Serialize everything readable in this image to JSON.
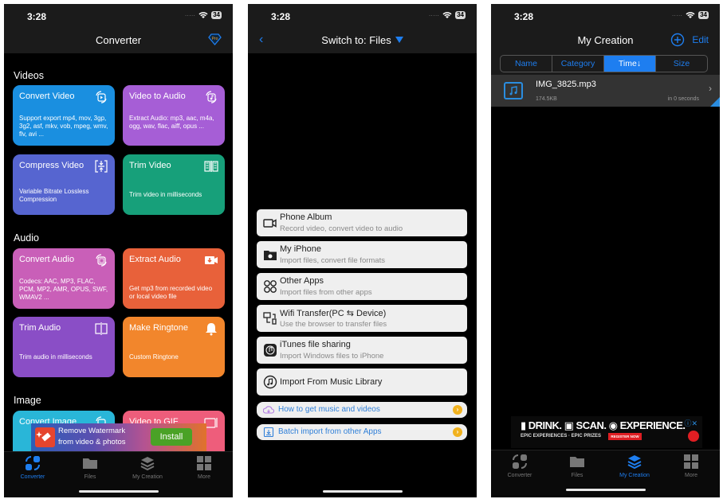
{
  "status": {
    "time": "3:28",
    "battery": "34"
  },
  "screen1": {
    "title": "Converter",
    "pro_badge": "Pro",
    "sections": {
      "videos": "Videos",
      "audio": "Audio",
      "image": "Image"
    },
    "cards": [
      {
        "title": "Convert Video",
        "desc": "Support export mp4, mov, 3gp, 3g2, asf, mkv, vob, mpeg, wmv, flv, avi ...",
        "icon": "convert-video-icon",
        "color": "#1a8fe0"
      },
      {
        "title": "Video to Audio",
        "desc": "Extract Audio: mp3, aac, m4a, ogg, wav, flac, aiff, opus ...",
        "icon": "video-to-audio-icon",
        "color": "#a65ed6"
      },
      {
        "title": "Compress Video",
        "desc": "Variable Bitrate Lossless Compression",
        "icon": "compress-icon",
        "color": "#5665d0"
      },
      {
        "title": "Trim Video",
        "desc": "Trim video in milliseconds",
        "icon": "film-trim-icon",
        "color": "#17a07a"
      },
      {
        "title": "Convert Audio",
        "desc": "Codecs: AAC, MP3, FLAC, PCM, MP2, AMR, OPUS, SWF, WMAV2 ...",
        "icon": "convert-audio-icon",
        "color": "#c95fb8"
      },
      {
        "title": "Extract Audio",
        "desc": "Get mp3 from recorded video or local video file",
        "icon": "video-download-icon",
        "color": "#e8613a"
      },
      {
        "title": "Trim Audio",
        "desc": "Trim audio in milliseconds",
        "icon": "trim-audio-icon",
        "color": "#8a4ec6"
      },
      {
        "title": "Make Ringtone",
        "desc": "Custom Ringtone",
        "icon": "bell-icon",
        "color": "#f2862c"
      },
      {
        "title": "Convert Image",
        "desc": "",
        "icon": "convert-image-icon",
        "color": "#29b6d8"
      },
      {
        "title": "Video to GIF",
        "desc": "",
        "icon": "gif-icon",
        "color": "#ee5d7b"
      }
    ],
    "ad": {
      "line1": "Remove Watermark",
      "line2": "from video & photos",
      "button": "Install"
    }
  },
  "tabs": [
    {
      "label": "Converter",
      "icon": "converter-icon"
    },
    {
      "label": "Files",
      "icon": "folder-icon"
    },
    {
      "label": "My Creation",
      "icon": "layers-icon"
    },
    {
      "label": "More",
      "icon": "grid-icon"
    }
  ],
  "screen2": {
    "title": "Switch to: Files",
    "options": [
      {
        "title": "Phone Album",
        "subtitle": "Record video, convert video to audio",
        "icon": "video-camera-icon"
      },
      {
        "title": "My iPhone",
        "subtitle": "Import files, convert file formats",
        "icon": "folder-apple-icon"
      },
      {
        "title": "Other Apps",
        "subtitle": "Import files from other apps",
        "icon": "apps-icon"
      },
      {
        "title": "Wifi Transfer(PC ⇆ Device)",
        "subtitle": "Use the browser to transfer files",
        "icon": "wifi-transfer-icon"
      },
      {
        "title": "iTunes file sharing",
        "subtitle": "Import Windows files to iPhone",
        "icon": "itunes-icon"
      },
      {
        "title": "Import From Music Library",
        "subtitle": "",
        "icon": "music-library-icon"
      }
    ],
    "links": [
      {
        "label": "How to get music and videos",
        "icon": "cloud-icon"
      },
      {
        "label": "Batch import from other Apps",
        "icon": "import-icon"
      }
    ]
  },
  "screen3": {
    "title": "My Creation",
    "edit_label": "Edit",
    "sort_tabs": [
      "Name",
      "Category",
      "Time↓",
      "Size"
    ],
    "active_sort": "Time↓",
    "files": [
      {
        "name": "IMG_3825.mp3",
        "size": "174.5KB",
        "time": "in 0 seconds"
      }
    ],
    "ad": {
      "headline": "▮ DRINK. ▣ SCAN. ◉ EXPERIENCE.",
      "sub": "EPIC EXPERIENCES · EPIC PRIZES",
      "button": "REGISTER NOW"
    }
  }
}
